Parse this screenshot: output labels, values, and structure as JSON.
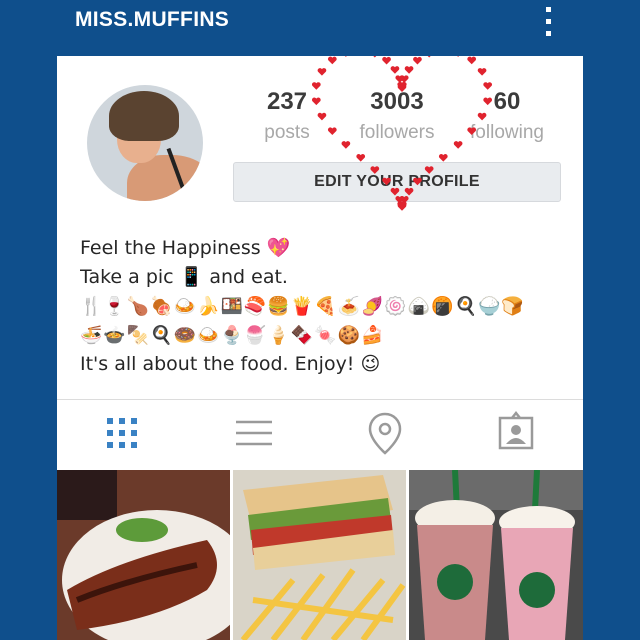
{
  "header": {
    "username": "MISS.MUFFINS"
  },
  "stats": [
    {
      "value": "237",
      "label": "posts"
    },
    {
      "value": "3003",
      "label": "followers"
    },
    {
      "value": "60",
      "label": "following"
    }
  ],
  "edit_button": "EDIT YOUR PROFILE",
  "bio": {
    "line1": "Feel the Happiness 💖",
    "line2": "Take a pic 📱 and eat.",
    "line3": "🍴🍷🍗🍖🍛🍌🍱🍣🍔🍟🍕🍝🍠🍥🍙🍘🍳🍚🍞",
    "line4": "🍜🍲🍢🍳🍩🍛🍨🍧🍦🍫🍬🍪🍰",
    "line5": "It's all about the food. Enjoy! 😉"
  },
  "tabs": [
    {
      "icon": "grid-icon",
      "active": true
    },
    {
      "icon": "list-icon",
      "active": false
    },
    {
      "icon": "location-pin-icon",
      "active": false
    },
    {
      "icon": "tagged-person-icon",
      "active": false
    }
  ],
  "colors": {
    "bar": "#0f4f8c",
    "accent": "#3a82c4",
    "heart": "#e0232e"
  }
}
